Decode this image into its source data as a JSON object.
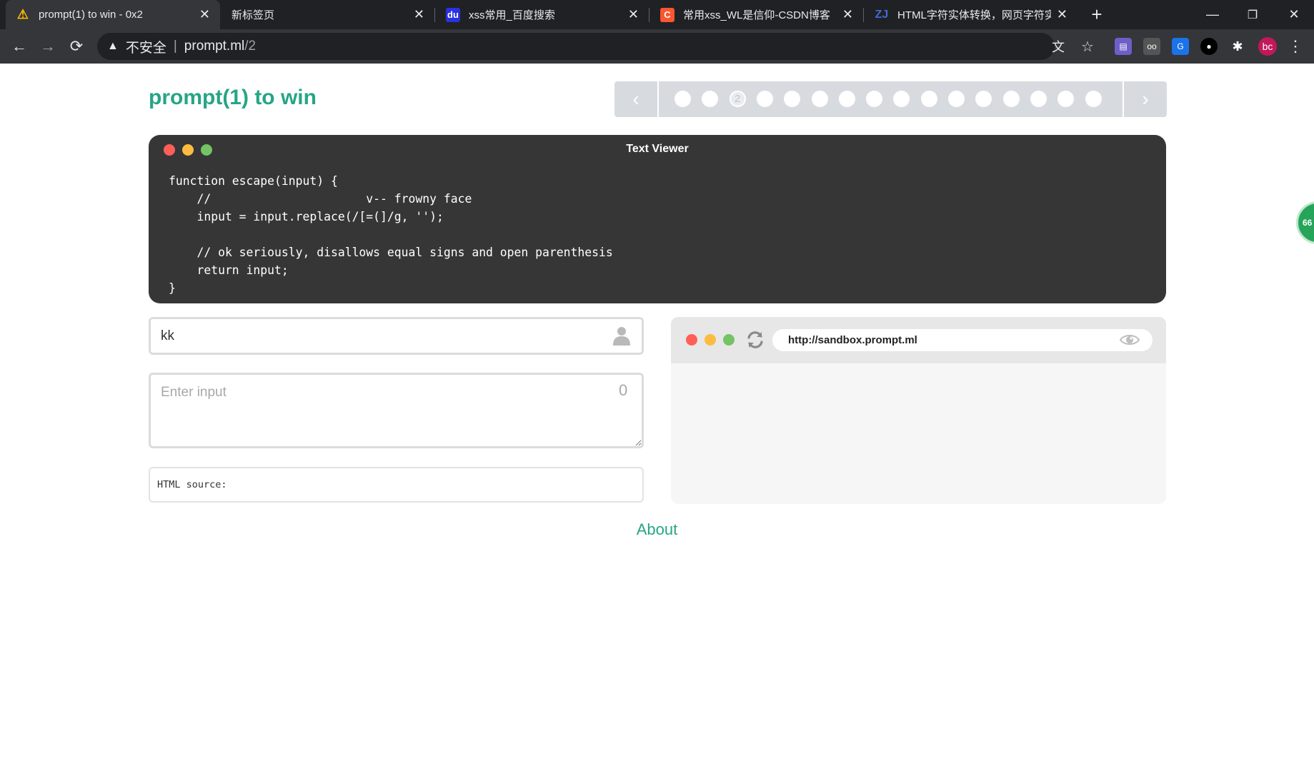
{
  "browser": {
    "tabs": [
      {
        "title": "prompt(1) to win - 0x2",
        "icon": "warning-icon",
        "active": true
      },
      {
        "title": "新标签页",
        "icon": "",
        "active": false
      },
      {
        "title": "xss常用_百度搜索",
        "icon": "baidu-icon",
        "active": false
      },
      {
        "title": "常用xss_WL是信仰-CSDN博客",
        "icon": "csdn-icon",
        "active": false
      },
      {
        "title": "HTML字符实体转换，网页字符实",
        "icon": "zj-icon",
        "active": false
      }
    ],
    "address": {
      "security_label": "不安全",
      "host": "prompt.ml",
      "path": "/2"
    },
    "profile_initials": "bc",
    "colors": {
      "frame": "#202124",
      "toolbar": "#35363a",
      "csdn": "#fc5531",
      "baidu": "#2932e1",
      "profile": "#c2185b"
    }
  },
  "page": {
    "title": "prompt(1) to win",
    "accent_color": "#26a586",
    "pager": {
      "prev_icon": "chevron-left-icon",
      "next_icon": "chevron-right-icon",
      "active_label": "2",
      "active_index": 2,
      "dot_count": 16
    },
    "text_viewer": {
      "title": "Text Viewer",
      "code": "function escape(input) {\n    //                      v-- frowny face\n    input = input.replace(/[=(]/g, '');\n\n    // ok seriously, disallows equal signs and open parenthesis\n    return input;\n}"
    },
    "name_input": {
      "value": "kk",
      "icon": "user-icon"
    },
    "payload_input": {
      "placeholder": "Enter input",
      "value": "",
      "counter": "0"
    },
    "html_source_label": "HTML source:",
    "sandbox": {
      "url": "http://sandbox.prompt.ml"
    },
    "about_link": "About"
  },
  "floating_badge": {
    "text": "66",
    "color": "#26a55a"
  }
}
